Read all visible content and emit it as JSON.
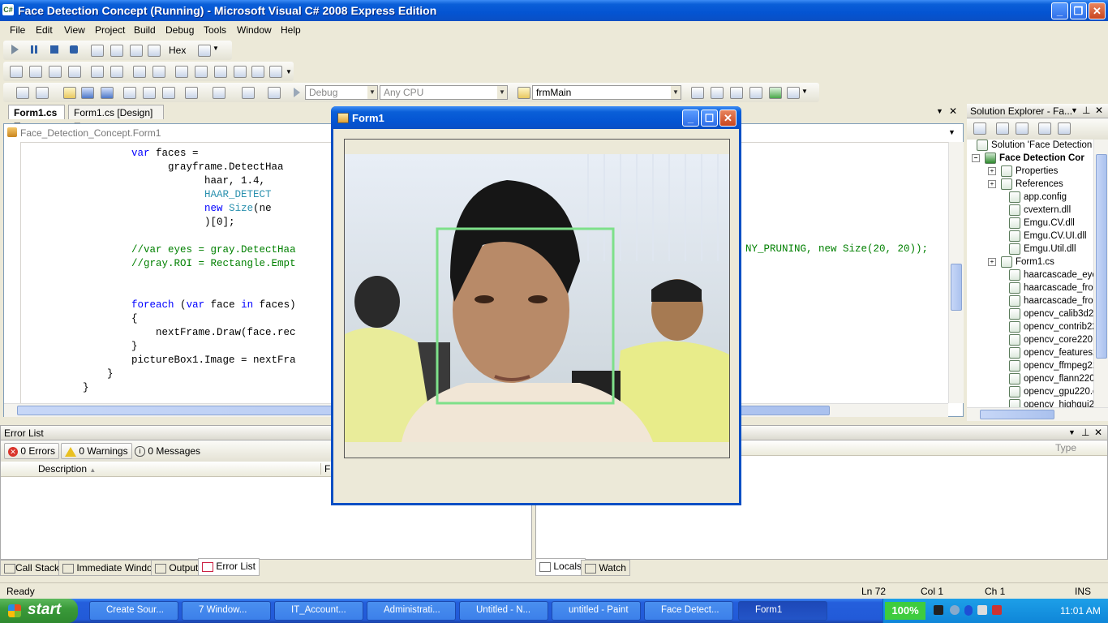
{
  "window": {
    "title": "Face Detection Concept (Running) - Microsoft Visual C# 2008 Express Edition"
  },
  "menu": [
    "File",
    "Edit",
    "View",
    "Project",
    "Build",
    "Debug",
    "Tools",
    "Window",
    "Help"
  ],
  "toolbar": {
    "hex_label": "Hex",
    "config_combo": "Debug",
    "platform_combo": "Any CPU",
    "find_combo": "frmMain"
  },
  "doctabs": {
    "tab1": "Form1.cs",
    "tab2": "Form1.cs [Design]"
  },
  "editor": {
    "nav_left": "Face_Detection_Concept.Form1",
    "code": {
      "l1a": "var",
      "l1b": " faces =",
      "l2": "grayframe.DetectHaa",
      "l3": "haar, 1.4,",
      "l4": "HAAR_DETECT",
      "l5a": "new ",
      "l5b": "Size",
      "l5c": "(ne",
      "l6": ")[0];",
      "l7": "//var eyes = gray.DetectHaa",
      "l7r": "NY_PRUNING, new Size(20, 20));",
      "l8": "//gray.ROI = Rectangle.Empt",
      "l9a": "foreach",
      "l9b": " (",
      "l9c": "var",
      "l9d": " face ",
      "l9e": "in",
      "l9f": " faces)",
      "l10": "{",
      "l11": "nextFrame.Draw(face.rec",
      "l12": "}",
      "l13": "pictureBox1.Image = nextFra",
      "l14": "}",
      "l15": "}"
    }
  },
  "solution_explorer": {
    "title": "Solution Explorer - Fa...",
    "root": "Solution 'Face Detection C",
    "project": "Face Detection Cor",
    "items": [
      "Properties",
      "References",
      "app.config",
      "cvextern.dll",
      "Emgu.CV.dll",
      "Emgu.CV.UI.dll",
      "Emgu.Util.dll",
      "Form1.cs",
      "haarcascade_eye",
      "haarcascade_fron",
      "haarcascade_fron",
      "opencv_calib3d22",
      "opencv_contrib22",
      "opencv_core220.c",
      "opencv_features2",
      "opencv_ffmpeg22",
      "opencv_flann220.",
      "opencv_gpu220.d",
      "opencv_highgui22"
    ]
  },
  "error_list": {
    "title": "Error List",
    "errors": "0 Errors",
    "warnings": "0 Warnings",
    "messages": "0 Messages",
    "col_description": "Description",
    "col_file": "File"
  },
  "right_panel": {
    "col_type": "Type"
  },
  "bottom_tabs_left": [
    "Call Stack",
    "Immediate Window",
    "Output",
    "Error List"
  ],
  "bottom_tabs_right": [
    "Locals",
    "Watch"
  ],
  "status": {
    "text": "Ready",
    "ln": "Ln 72",
    "col": "Col 1",
    "ch": "Ch 1",
    "mode": "INS"
  },
  "form1": {
    "title": "Form1"
  },
  "taskbar": {
    "start": "start",
    "tasks": [
      "Create Sour...",
      "7 Window...",
      "IT_Account...",
      "Administrati...",
      "Untitled - N...",
      "untitled - Paint",
      "Face Detect...",
      "Form1"
    ],
    "zoom": "100%",
    "clock": "11:01 AM"
  },
  "colors": {
    "title_blue": "#0454d2",
    "taskbar_blue": "#245fdc",
    "start_green": "#3a9a3a",
    "detect_box": "#7ee08a"
  }
}
